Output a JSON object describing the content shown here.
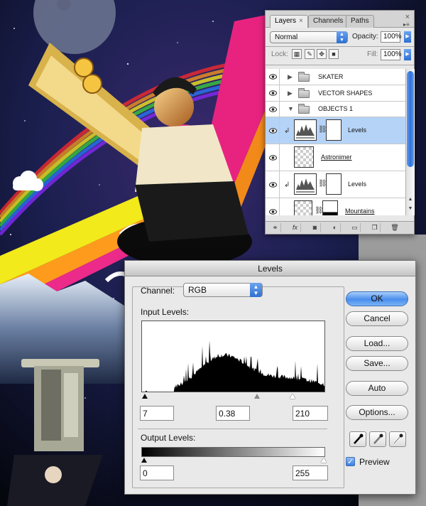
{
  "layers_panel": {
    "tabs": [
      {
        "label": "Layers",
        "close": "×"
      },
      {
        "label": "Channels"
      },
      {
        "label": "Paths"
      }
    ],
    "close": "×",
    "blend_mode": "Normal",
    "opacity_label": "Opacity:",
    "opacity_value": "100%",
    "lock_label": "Lock:",
    "fill_label": "Fill:",
    "fill_value": "100%",
    "layers": [
      {
        "name": "SKATER"
      },
      {
        "name": "VECTOR SHAPES"
      },
      {
        "name": "OBJECTS 1"
      },
      {
        "name": "Levels"
      },
      {
        "name": "Astronimer"
      },
      {
        "name": "Levels"
      },
      {
        "name": "Mountains"
      }
    ],
    "bottom_icons": [
      "link-icon",
      "fx-icon",
      "mask-icon",
      "adjustment-icon",
      "folder-icon",
      "new-layer-icon",
      "trash-icon"
    ],
    "bottom_labels": {
      "fx": "fx"
    }
  },
  "levels_dialog": {
    "title": "Levels",
    "channel_label": "Channel:",
    "channel_value": "RGB",
    "input_levels_label": "Input Levels:",
    "input_black": "7",
    "input_gamma": "0.38",
    "input_white": "210",
    "output_levels_label": "Output Levels:",
    "output_black": "0",
    "output_white": "255",
    "buttons": {
      "ok": "OK",
      "cancel": "Cancel",
      "load": "Load...",
      "save": "Save...",
      "auto": "Auto",
      "options": "Options..."
    },
    "preview_label": "Preview",
    "preview_checked": true,
    "colors": {
      "default_button": "#4a8ded",
      "selection": "#b5d3f7"
    }
  }
}
